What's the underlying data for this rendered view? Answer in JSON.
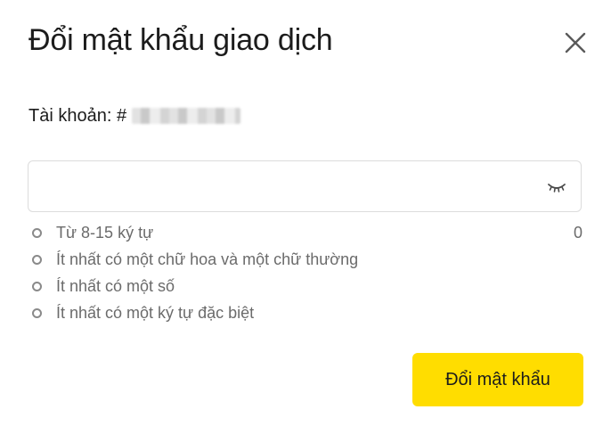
{
  "dialog": {
    "title": "Đổi mật khẩu giao dịch",
    "close_icon": "close-icon"
  },
  "account": {
    "label": "Tài khoản: #"
  },
  "password": {
    "value": "",
    "placeholder": "",
    "toggle_icon": "eye-closed-icon",
    "char_count": "0"
  },
  "rules": [
    {
      "text": "Từ 8-15 ký tự"
    },
    {
      "text": "Ít nhất có một chữ hoa và một chữ thường"
    },
    {
      "text": "Ít nhất có một số"
    },
    {
      "text": "Ít nhất có một ký tự đặc biệt"
    }
  ],
  "actions": {
    "submit_label": "Đổi mật khẩu"
  },
  "colors": {
    "primary": "#ffdd00",
    "text": "#1c1c1c",
    "muted": "#6b6b6b",
    "border": "#dcdcdc"
  }
}
